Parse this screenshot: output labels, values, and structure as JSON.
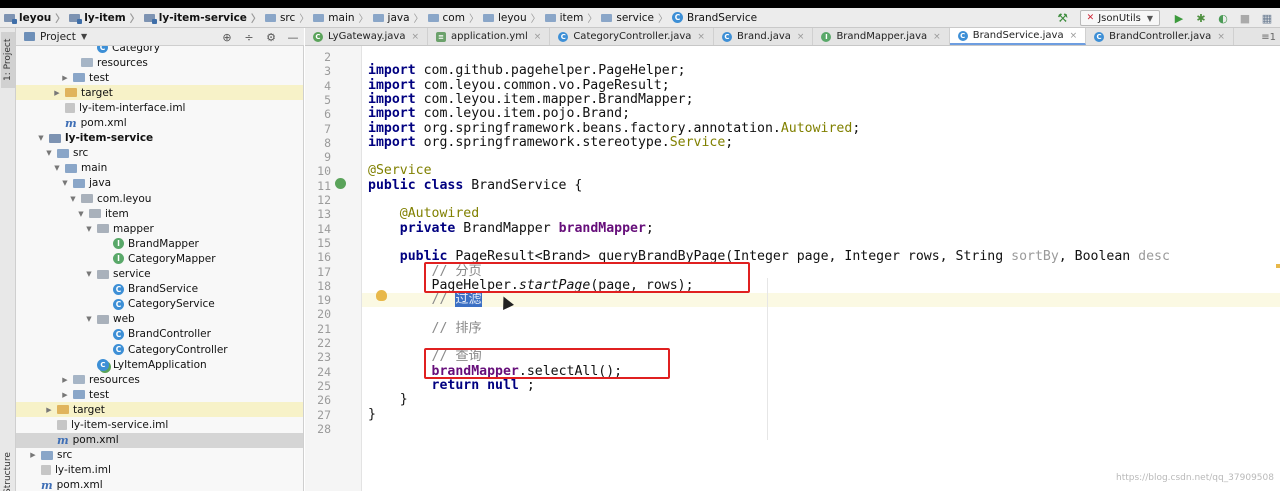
{
  "breadcrumbs": [
    {
      "label": "leyou",
      "icon": "module-folder-icon",
      "bold": true
    },
    {
      "label": "ly-item",
      "icon": "module-folder-icon",
      "bold": true
    },
    {
      "label": "ly-item-service",
      "icon": "module-folder-icon",
      "bold": true
    },
    {
      "label": "src",
      "icon": "folder-icon",
      "bold": false
    },
    {
      "label": "main",
      "icon": "folder-icon",
      "bold": false
    },
    {
      "label": "java",
      "icon": "folder-icon",
      "bold": false
    },
    {
      "label": "com",
      "icon": "folder-icon",
      "bold": false
    },
    {
      "label": "leyou",
      "icon": "folder-icon",
      "bold": false
    },
    {
      "label": "item",
      "icon": "folder-icon",
      "bold": false
    },
    {
      "label": "service",
      "icon": "folder-icon",
      "bold": false
    },
    {
      "label": "BrandService",
      "icon": "class-icon",
      "bold": false
    }
  ],
  "toolbar": {
    "run_config": "JsonUtils"
  },
  "side_tabs": {
    "project": "1: Project",
    "structure": "Structure"
  },
  "project_panel": {
    "title": "Project"
  },
  "tree": [
    {
      "label": "Category",
      "indent": 8,
      "icon": "class",
      "arrow": ""
    },
    {
      "label": "resources",
      "indent": 6,
      "icon": "res",
      "arrow": ""
    },
    {
      "label": "test",
      "indent": 5,
      "icon": "folder",
      "arrow": "▶"
    },
    {
      "label": "target",
      "indent": 4,
      "icon": "orange",
      "arrow": "▶",
      "highlight": true
    },
    {
      "label": "ly-item-interface.iml",
      "indent": 4,
      "icon": "iml",
      "arrow": ""
    },
    {
      "label": "pom.xml",
      "indent": 4,
      "icon": "m",
      "arrow": ""
    },
    {
      "label": "ly-item-service",
      "indent": 2,
      "icon": "module",
      "arrow": "▼",
      "bold": true
    },
    {
      "label": "src",
      "indent": 3,
      "icon": "folder",
      "arrow": "▼"
    },
    {
      "label": "main",
      "indent": 4,
      "icon": "folder",
      "arrow": "▼"
    },
    {
      "label": "java",
      "indent": 5,
      "icon": "folder",
      "arrow": "▼"
    },
    {
      "label": "com.leyou",
      "indent": 6,
      "icon": "grey",
      "arrow": "▼"
    },
    {
      "label": "item",
      "indent": 7,
      "icon": "grey",
      "arrow": "▼"
    },
    {
      "label": "mapper",
      "indent": 8,
      "icon": "grey",
      "arrow": "▼"
    },
    {
      "label": "BrandMapper",
      "indent": 10,
      "icon": "interface",
      "arrow": ""
    },
    {
      "label": "CategoryMapper",
      "indent": 10,
      "icon": "interface",
      "arrow": ""
    },
    {
      "label": "service",
      "indent": 8,
      "icon": "grey",
      "arrow": "▼"
    },
    {
      "label": "BrandService",
      "indent": 10,
      "icon": "class",
      "arrow": ""
    },
    {
      "label": "CategoryService",
      "indent": 10,
      "icon": "class",
      "arrow": ""
    },
    {
      "label": "web",
      "indent": 8,
      "icon": "grey",
      "arrow": "▼"
    },
    {
      "label": "BrandController",
      "indent": 10,
      "icon": "class",
      "arrow": ""
    },
    {
      "label": "CategoryController",
      "indent": 10,
      "icon": "class",
      "arrow": ""
    },
    {
      "label": "LyItemApplication",
      "indent": 8,
      "icon": "app",
      "arrow": ""
    },
    {
      "label": "resources",
      "indent": 5,
      "icon": "res",
      "arrow": "▶"
    },
    {
      "label": "test",
      "indent": 5,
      "icon": "folder",
      "arrow": "▶"
    },
    {
      "label": "target",
      "indent": 3,
      "icon": "orange",
      "arrow": "▶",
      "highlight": true
    },
    {
      "label": "ly-item-service.iml",
      "indent": 3,
      "icon": "iml",
      "arrow": ""
    },
    {
      "label": "pom.xml",
      "indent": 3,
      "icon": "m",
      "arrow": "",
      "selected": true
    },
    {
      "label": "src",
      "indent": 1,
      "icon": "folder",
      "arrow": "▶"
    },
    {
      "label": "ly-item.iml",
      "indent": 1,
      "icon": "iml",
      "arrow": ""
    },
    {
      "label": "pom.xml",
      "indent": 1,
      "icon": "m",
      "arrow": ""
    }
  ],
  "editor_tabs": [
    {
      "label": "LyGateway.java",
      "icon": "g",
      "active": false
    },
    {
      "label": "application.yml",
      "icon": "y",
      "active": false
    },
    {
      "label": "CategoryController.java",
      "icon": "c",
      "active": false
    },
    {
      "label": "Brand.java",
      "icon": "c",
      "active": false
    },
    {
      "label": "BrandMapper.java",
      "icon": "i",
      "active": false
    },
    {
      "label": "BrandService.java",
      "icon": "c",
      "active": true
    },
    {
      "label": "BrandController.java",
      "icon": "c",
      "active": false
    }
  ],
  "tab_overflow": "≡1",
  "code": {
    "line_numbers": [
      "2",
      "3",
      "4",
      "5",
      "6",
      "7",
      "8",
      "9",
      "10",
      "11",
      "12",
      "13",
      "14",
      "15",
      "16",
      "17",
      "18",
      "19",
      "20",
      "21",
      "22",
      "23",
      "24",
      "25",
      "26",
      "27",
      "28"
    ],
    "lines": [
      {
        "n": 2,
        "parts": []
      },
      {
        "n": 3,
        "parts": [
          [
            "kw",
            "import"
          ],
          [
            "",
            "com.github.pagehelper.PageHelper;"
          ]
        ]
      },
      {
        "n": 4,
        "parts": [
          [
            "kw",
            "import"
          ],
          [
            "",
            "com.leyou.common.vo.PageResult;"
          ]
        ]
      },
      {
        "n": 5,
        "parts": [
          [
            "kw",
            "import"
          ],
          [
            "",
            "com.leyou.item.mapper.BrandMapper;"
          ]
        ]
      },
      {
        "n": 6,
        "parts": [
          [
            "kw",
            "import"
          ],
          [
            "",
            "com.leyou.item.pojo.Brand;"
          ]
        ]
      },
      {
        "n": 7,
        "parts": [
          [
            "kw",
            "import"
          ],
          [
            "",
            "org.springframework.beans.factory.annotation."
          ],
          [
            "ann",
            "Autowired"
          ],
          [
            "",
            ";"
          ]
        ]
      },
      {
        "n": 8,
        "parts": [
          [
            "kw",
            "import"
          ],
          [
            "",
            "org.springframework.stereotype."
          ],
          [
            "ann",
            "Service"
          ],
          [
            "",
            ";"
          ]
        ]
      },
      {
        "n": 9,
        "parts": []
      },
      {
        "n": 10,
        "parts": [
          [
            "ann",
            "@Service"
          ]
        ]
      },
      {
        "n": 11,
        "parts": [
          [
            "kw",
            "public class"
          ],
          [
            "",
            "BrandService {"
          ]
        ]
      },
      {
        "n": 12,
        "parts": []
      },
      {
        "n": 13,
        "parts": [
          [
            "",
            "    "
          ],
          [
            "ann",
            "@Autowired"
          ]
        ]
      },
      {
        "n": 14,
        "parts": [
          [
            "",
            "    "
          ],
          [
            "kw",
            "private"
          ],
          [
            "",
            "BrandMapper "
          ],
          [
            "fld",
            "brandMapper"
          ],
          [
            "",
            ";"
          ]
        ]
      },
      {
        "n": 15,
        "parts": []
      },
      {
        "n": 16,
        "parts": [
          [
            "",
            "    "
          ],
          [
            "kw",
            "public"
          ],
          [
            "",
            "PageResult<Brand> queryBrandByPage(Integer page, Integer rows, String "
          ],
          [
            "par",
            "sortBy"
          ],
          [
            "",
            ", Boolean "
          ],
          [
            "par",
            "desc"
          ]
        ]
      },
      {
        "n": 17,
        "parts": [
          [
            "",
            "        "
          ],
          [
            "cm",
            "// 分页"
          ]
        ]
      },
      {
        "n": 18,
        "parts": [
          [
            "",
            "        PageHelper."
          ],
          [
            "it",
            "startPage"
          ],
          [
            "",
            "(page, rows);"
          ]
        ]
      },
      {
        "n": 19,
        "parts": [
          [
            "",
            "        "
          ],
          [
            "cm",
            "// "
          ],
          [
            "sel",
            "过滤"
          ]
        ],
        "current": true
      },
      {
        "n": 20,
        "parts": []
      },
      {
        "n": 21,
        "parts": [
          [
            "",
            "        "
          ],
          [
            "cm",
            "// 排序"
          ]
        ]
      },
      {
        "n": 22,
        "parts": []
      },
      {
        "n": 23,
        "parts": [
          [
            "",
            "        "
          ],
          [
            "cm",
            "// 查询"
          ]
        ]
      },
      {
        "n": 24,
        "parts": [
          [
            "",
            "        "
          ],
          [
            "fld",
            "brandMapper"
          ],
          [
            "",
            ".selectAll();"
          ]
        ]
      },
      {
        "n": 25,
        "parts": [
          [
            "",
            "        "
          ],
          [
            "kw",
            "return null"
          ],
          [
            "",
            ";"
          ]
        ]
      },
      {
        "n": 26,
        "parts": [
          [
            "",
            "    }"
          ]
        ]
      },
      {
        "n": 27,
        "parts": [
          [
            "",
            "}"
          ]
        ]
      },
      {
        "n": 28,
        "parts": []
      }
    ]
  },
  "watermark": "https://blog.csdn.net/qq_37909508"
}
